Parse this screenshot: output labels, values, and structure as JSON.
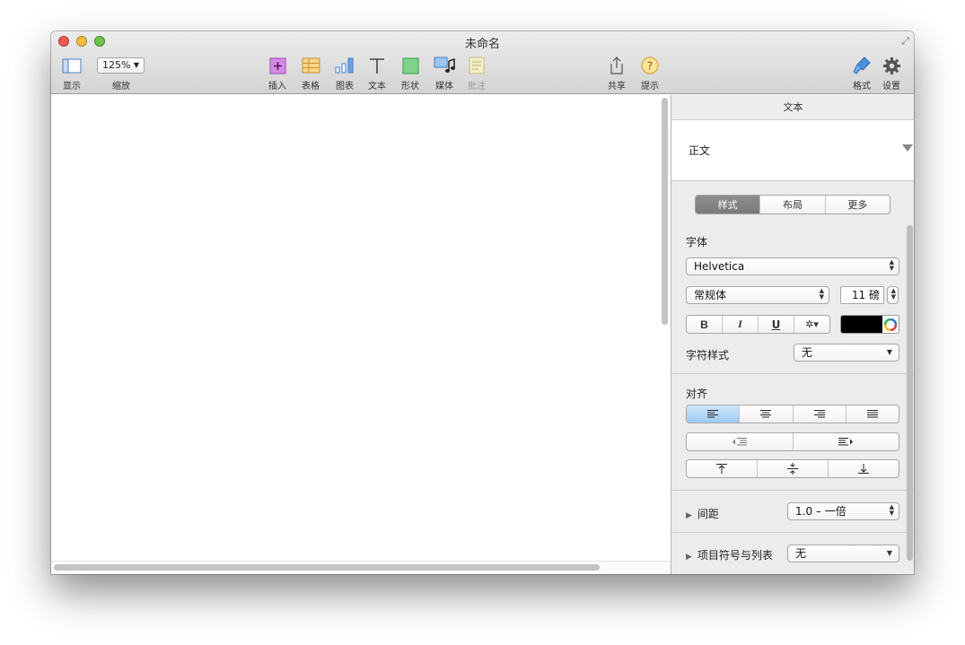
{
  "window": {
    "title": "未命名"
  },
  "toolbar": {
    "view_label": "显示",
    "zoom_value": "125%",
    "zoom_label": "缩放",
    "insert_label": "插入",
    "table_label": "表格",
    "chart_label": "图表",
    "text_label": "文本",
    "shape_label": "形状",
    "media_label": "媒体",
    "comment_label": "批注",
    "share_label": "共享",
    "tips_label": "提示",
    "format_label": "格式",
    "settings_label": "设置"
  },
  "inspector": {
    "header": "文本",
    "paragraph_style": "正文",
    "tabs": [
      "样式",
      "布局",
      "更多"
    ],
    "font_section": "字体",
    "font_family": "Helvetica",
    "font_typeface": "常规体",
    "font_size": "11 磅",
    "bold": "B",
    "italic": "I",
    "underline": "U",
    "gear": "✲▾",
    "text_color": "#000000",
    "char_style_label": "字符样式",
    "char_style_value": "无",
    "align_section": "对齐",
    "spacing_label": "间距",
    "spacing_value": "1.0 – 一倍",
    "bullets_label": "项目符号与列表",
    "bullets_value": "无"
  }
}
